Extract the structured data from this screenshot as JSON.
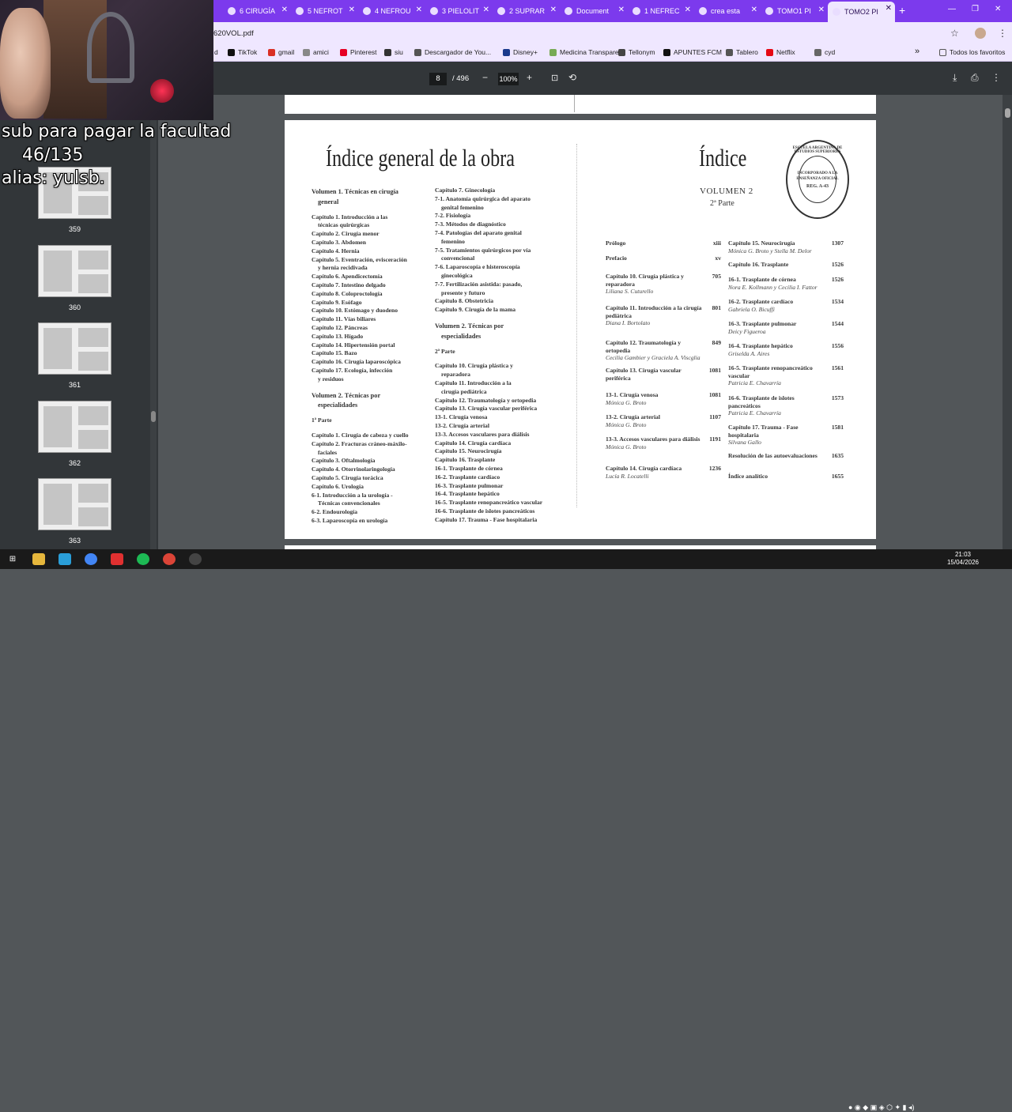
{
  "tabs": [
    {
      "label": "6 CIRUGÍA",
      "icon": "drive-icon"
    },
    {
      "label": "5 NEFROT",
      "icon": "drive-icon"
    },
    {
      "label": "4 NEFROU",
      "icon": "drive-icon"
    },
    {
      "label": "3 PIELOLIT",
      "icon": "drive-icon"
    },
    {
      "label": "2 SUPRAR",
      "icon": "drive-icon"
    },
    {
      "label": "Document",
      "icon": "docs-icon"
    },
    {
      "label": "1 NEFREC",
      "icon": "drive-icon"
    },
    {
      "label": "crea esta",
      "icon": "gemini-icon"
    },
    {
      "label": "TOMO1 PI",
      "icon": "globe-icon"
    },
    {
      "label": "TOMO2 PI",
      "icon": "globe-icon",
      "active": true
    }
  ],
  "address": {
    "url": "620VOL.pdf"
  },
  "bookmarks": [
    {
      "label": "d"
    },
    {
      "label": "TikTok"
    },
    {
      "label": "gmail"
    },
    {
      "label": "amici"
    },
    {
      "label": "Pinterest"
    },
    {
      "label": "siu"
    },
    {
      "label": "Descargador de You..."
    },
    {
      "label": "Disney+"
    },
    {
      "label": "Medicina Transpare..."
    },
    {
      "label": "Tellonym"
    },
    {
      "label": "APUNTES FCM"
    },
    {
      "label": "Tablero"
    },
    {
      "label": "Netflix"
    },
    {
      "label": "cyd"
    }
  ],
  "bookmarks_more": "»",
  "bookmarks_all": "Todos los favoritos",
  "pdf_toolbar": {
    "page_current": "8",
    "page_total": "/ 496",
    "zoom": "100%",
    "zoom_out": "−",
    "zoom_in": "+"
  },
  "thumbnails": [
    {
      "label": "359"
    },
    {
      "label": "360"
    },
    {
      "label": "361"
    },
    {
      "label": "362"
    },
    {
      "label": "363"
    }
  ],
  "stream_overlay": {
    "line1": "sub para pagar la facultad",
    "line2": "46/135",
    "line3": "alias: yulsb."
  },
  "page": {
    "left_title": "Índice general de la obra",
    "right_title": "Índice",
    "volume": "VOLUMEN 2",
    "part": "2ª Parte",
    "stamp_text": [
      "ESCUELA ARGENTINA DE ESTUDIOS SUPERIORES",
      "INCORPORADO A LA",
      "ENSEÑANZA OFICIAL",
      "REG. A-43"
    ],
    "col1": [
      {
        "t": "Volumen 1. Técnicas en cirugía",
        "c": "hd"
      },
      {
        "t": "general",
        "c": "hd ind"
      },
      {
        "t": "",
        "c": "gap"
      },
      {
        "t": "Capítulo 1. Introducción a las"
      },
      {
        "t": "técnicas quirúrgicas",
        "c": "ind"
      },
      {
        "t": "Capítulo 2. Cirugía menor"
      },
      {
        "t": "Capítulo 3. Abdomen"
      },
      {
        "t": "Capítulo 4. Hernia"
      },
      {
        "t": "Capítulo 5. Eventración, evisceración"
      },
      {
        "t": "y hernia recidivada",
        "c": "ind"
      },
      {
        "t": "Capítulo 6. Apendicectomía"
      },
      {
        "t": "Capítulo 7. Intestino delgado"
      },
      {
        "t": "Capítulo 8. Coloproctología"
      },
      {
        "t": "Capítulo 9. Esófago"
      },
      {
        "t": "Capítulo 10. Estómago y duodeno"
      },
      {
        "t": "Capítulo 11. Vías biliares"
      },
      {
        "t": "Capítulo 12. Páncreas"
      },
      {
        "t": "Capítulo 13. Hígado"
      },
      {
        "t": "Capítulo 14. Hipertensión portal"
      },
      {
        "t": "Capítulo 15. Bazo"
      },
      {
        "t": "Capítulo 16. Cirugía laparoscópica"
      },
      {
        "t": "Capítulo 17. Ecología, infección"
      },
      {
        "t": "y residuos",
        "c": "ind"
      },
      {
        "t": "",
        "c": "gap"
      },
      {
        "t": "Volumen 2. Técnicas por",
        "c": "hd"
      },
      {
        "t": "especialidades",
        "c": "hd ind"
      },
      {
        "t": "",
        "c": "gap"
      },
      {
        "t": "1ª Parte"
      },
      {
        "t": "",
        "c": "gap"
      },
      {
        "t": "Capítulo 1. Cirugía de cabeza y cuello"
      },
      {
        "t": "Capítulo 2. Fracturas cráneo-máxilo-"
      },
      {
        "t": "faciales",
        "c": "ind"
      },
      {
        "t": "Capítulo 3. Oftalmología"
      },
      {
        "t": "Capítulo 4. Otorrinolaringología"
      },
      {
        "t": "Capítulo 5. Cirugía torácica"
      },
      {
        "t": "Capítulo 6. Urología"
      },
      {
        "t": "6-1. Introducción a la urología -"
      },
      {
        "t": "Técnicas convencionales",
        "c": "ind"
      },
      {
        "t": "6-2. Endourología"
      },
      {
        "t": "6-3. Laparoscopía en urología"
      }
    ],
    "col2": [
      {
        "t": "Capítulo 7. Ginecología"
      },
      {
        "t": "7-1. Anatomía quirúrgica del aparato"
      },
      {
        "t": "genital femenino",
        "c": "ind"
      },
      {
        "t": "7-2. Fisiología"
      },
      {
        "t": "7-3. Métodos de diagnóstico"
      },
      {
        "t": "7-4. Patologías del aparato genital"
      },
      {
        "t": "femenino",
        "c": "ind"
      },
      {
        "t": "7-5. Tratamientos quirúrgicos por vía"
      },
      {
        "t": "convencional",
        "c": "ind"
      },
      {
        "t": "7-6. Laparoscopía e histeroscopía"
      },
      {
        "t": "ginecológica",
        "c": "ind"
      },
      {
        "t": "7-7. Fertilización asistida: pasado,"
      },
      {
        "t": "presente y futuro",
        "c": "ind"
      },
      {
        "t": "Capítulo 8. Obstetricia"
      },
      {
        "t": "Capítulo 9. Cirugía de la mama"
      },
      {
        "t": "",
        "c": "gap"
      },
      {
        "t": "Volumen 2. Técnicas por",
        "c": "hd"
      },
      {
        "t": "especialidades",
        "c": "hd ind"
      },
      {
        "t": "",
        "c": "gap"
      },
      {
        "t": "2ª Parte"
      },
      {
        "t": "",
        "c": "gap"
      },
      {
        "t": "Capítulo 10. Cirugía plástica y"
      },
      {
        "t": "reparadora",
        "c": "ind"
      },
      {
        "t": "Capítulo 11. Introducción a la"
      },
      {
        "t": "cirugía pediátrica",
        "c": "ind"
      },
      {
        "t": "Capítulo 12. Traumatología y ortopedia"
      },
      {
        "t": "Capítulo 13. Cirugía vascular periférica"
      },
      {
        "t": "13-1. Cirugía venosa"
      },
      {
        "t": "13-2. Cirugía arterial"
      },
      {
        "t": "13-3. Accesos vasculares para diálisis"
      },
      {
        "t": "Capítulo 14. Cirugía cardíaca"
      },
      {
        "t": "Capítulo 15. Neurocirugía"
      },
      {
        "t": "Capítulo 16. Trasplante"
      },
      {
        "t": "16-1. Trasplante de córnea"
      },
      {
        "t": "16-2. Trasplante cardíaco"
      },
      {
        "t": "16-3. Trasplante pulmonar"
      },
      {
        "t": "16-4. Trasplante hepático"
      },
      {
        "t": "16-5. Trasplante renopancreático vascular"
      },
      {
        "t": "16-6. Trasplante de islotes pancreáticos"
      },
      {
        "t": "Capítulo 17. Trauma - Fase hospitalaria"
      }
    ],
    "toc_left": [
      {
        "title": "Prólogo",
        "page": "xiii"
      },
      {
        "title": "Prefacio",
        "page": "xv"
      },
      {
        "title": "Capítulo 10. Cirugía plástica y reparadora",
        "author": "Liliana S. Cuturello",
        "page": "705"
      },
      {
        "title": "Capítulo 11. Introducción a la cirugía pediátrica",
        "author": "Diana I. Bortolato",
        "page": "801"
      },
      {
        "title": "Capítulo 12. Traumatología y ortopedia",
        "author": "Cecilia Gambier y Graciela A. Viscglia",
        "page": "849"
      },
      {
        "title": "Capítulo 13. Cirugía vascular periférica",
        "page": "1081"
      },
      {
        "title": "13-1. Cirugía venosa",
        "author": "Mónica G. Broto",
        "page": "1081"
      },
      {
        "title": "13-2. Cirugía arterial",
        "author": "Mónica G. Broto",
        "page": "1107"
      },
      {
        "title": "13-3. Accesos vasculares para diálisis",
        "author": "Mónica G. Broto",
        "page": "1191"
      },
      {
        "title": "Capítulo 14. Cirugía cardíaca",
        "author": "Lucía R. Locatelli",
        "page": "1236"
      }
    ],
    "toc_right": [
      {
        "title": "Capítulo 15. Neurocirugía",
        "author": "Mónica G. Broto y Stella M. Delor",
        "page": "1307"
      },
      {
        "title": "Capítulo 16. Trasplante",
        "page": "1526"
      },
      {
        "title": "16-1. Trasplante de córnea",
        "author": "Nora E. Kollmann y Cecilia I. Fattor",
        "page": "1526"
      },
      {
        "title": "16-2. Trasplante cardíaco",
        "author": "Gabriela O. Bicuffi",
        "page": "1534"
      },
      {
        "title": "16-3. Trasplante pulmonar",
        "author": "Deicy Figueroa",
        "page": "1544"
      },
      {
        "title": "16-4. Trasplante hepático",
        "author": "Griselda A. Aires",
        "page": "1556"
      },
      {
        "title": "16-5. Trasplante renopancreático vascular",
        "author": "Patricia E. Chavarría",
        "page": "1561"
      },
      {
        "title": "16-6. Trasplante de islotes pancreáticos",
        "author": "Patricia E. Chavarría",
        "page": "1573"
      },
      {
        "title": "Capítulo 17. Trauma - Fase hospitalaria",
        "author": "Silvana Gallo",
        "page": "1581"
      },
      {
        "title": "Resolución de las autoevaluaciones",
        "page": "1635"
      },
      {
        "title": "Índice analítico",
        "page": "1655"
      }
    ]
  },
  "taskbar": {
    "time": "21:03",
    "date": "15/04/2026"
  },
  "colors": {
    "tabstrip": "#7c3aed",
    "toolbar": "#323639",
    "pdf_bg": "#525659"
  }
}
